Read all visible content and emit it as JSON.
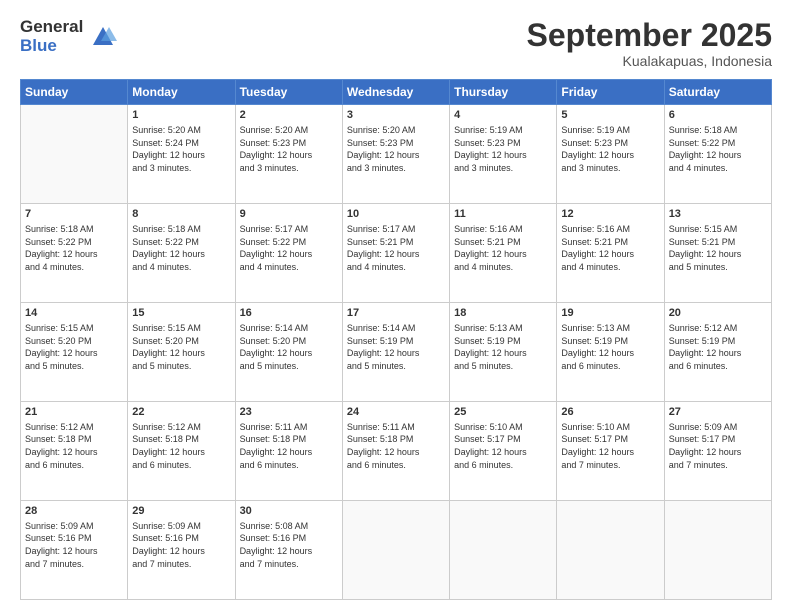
{
  "logo": {
    "general": "General",
    "blue": "Blue"
  },
  "title": "September 2025",
  "subtitle": "Kualakapuas, Indonesia",
  "days_header": [
    "Sunday",
    "Monday",
    "Tuesday",
    "Wednesday",
    "Thursday",
    "Friday",
    "Saturday"
  ],
  "weeks": [
    [
      {
        "day": "",
        "info": ""
      },
      {
        "day": "1",
        "info": "Sunrise: 5:20 AM\nSunset: 5:24 PM\nDaylight: 12 hours\nand 3 minutes."
      },
      {
        "day": "2",
        "info": "Sunrise: 5:20 AM\nSunset: 5:23 PM\nDaylight: 12 hours\nand 3 minutes."
      },
      {
        "day": "3",
        "info": "Sunrise: 5:20 AM\nSunset: 5:23 PM\nDaylight: 12 hours\nand 3 minutes."
      },
      {
        "day": "4",
        "info": "Sunrise: 5:19 AM\nSunset: 5:23 PM\nDaylight: 12 hours\nand 3 minutes."
      },
      {
        "day": "5",
        "info": "Sunrise: 5:19 AM\nSunset: 5:23 PM\nDaylight: 12 hours\nand 3 minutes."
      },
      {
        "day": "6",
        "info": "Sunrise: 5:18 AM\nSunset: 5:22 PM\nDaylight: 12 hours\nand 4 minutes."
      }
    ],
    [
      {
        "day": "7",
        "info": "Sunrise: 5:18 AM\nSunset: 5:22 PM\nDaylight: 12 hours\nand 4 minutes."
      },
      {
        "day": "8",
        "info": "Sunrise: 5:18 AM\nSunset: 5:22 PM\nDaylight: 12 hours\nand 4 minutes."
      },
      {
        "day": "9",
        "info": "Sunrise: 5:17 AM\nSunset: 5:22 PM\nDaylight: 12 hours\nand 4 minutes."
      },
      {
        "day": "10",
        "info": "Sunrise: 5:17 AM\nSunset: 5:21 PM\nDaylight: 12 hours\nand 4 minutes."
      },
      {
        "day": "11",
        "info": "Sunrise: 5:16 AM\nSunset: 5:21 PM\nDaylight: 12 hours\nand 4 minutes."
      },
      {
        "day": "12",
        "info": "Sunrise: 5:16 AM\nSunset: 5:21 PM\nDaylight: 12 hours\nand 4 minutes."
      },
      {
        "day": "13",
        "info": "Sunrise: 5:15 AM\nSunset: 5:21 PM\nDaylight: 12 hours\nand 5 minutes."
      }
    ],
    [
      {
        "day": "14",
        "info": "Sunrise: 5:15 AM\nSunset: 5:20 PM\nDaylight: 12 hours\nand 5 minutes."
      },
      {
        "day": "15",
        "info": "Sunrise: 5:15 AM\nSunset: 5:20 PM\nDaylight: 12 hours\nand 5 minutes."
      },
      {
        "day": "16",
        "info": "Sunrise: 5:14 AM\nSunset: 5:20 PM\nDaylight: 12 hours\nand 5 minutes."
      },
      {
        "day": "17",
        "info": "Sunrise: 5:14 AM\nSunset: 5:19 PM\nDaylight: 12 hours\nand 5 minutes."
      },
      {
        "day": "18",
        "info": "Sunrise: 5:13 AM\nSunset: 5:19 PM\nDaylight: 12 hours\nand 5 minutes."
      },
      {
        "day": "19",
        "info": "Sunrise: 5:13 AM\nSunset: 5:19 PM\nDaylight: 12 hours\nand 6 minutes."
      },
      {
        "day": "20",
        "info": "Sunrise: 5:12 AM\nSunset: 5:19 PM\nDaylight: 12 hours\nand 6 minutes."
      }
    ],
    [
      {
        "day": "21",
        "info": "Sunrise: 5:12 AM\nSunset: 5:18 PM\nDaylight: 12 hours\nand 6 minutes."
      },
      {
        "day": "22",
        "info": "Sunrise: 5:12 AM\nSunset: 5:18 PM\nDaylight: 12 hours\nand 6 minutes."
      },
      {
        "day": "23",
        "info": "Sunrise: 5:11 AM\nSunset: 5:18 PM\nDaylight: 12 hours\nand 6 minutes."
      },
      {
        "day": "24",
        "info": "Sunrise: 5:11 AM\nSunset: 5:18 PM\nDaylight: 12 hours\nand 6 minutes."
      },
      {
        "day": "25",
        "info": "Sunrise: 5:10 AM\nSunset: 5:17 PM\nDaylight: 12 hours\nand 6 minutes."
      },
      {
        "day": "26",
        "info": "Sunrise: 5:10 AM\nSunset: 5:17 PM\nDaylight: 12 hours\nand 7 minutes."
      },
      {
        "day": "27",
        "info": "Sunrise: 5:09 AM\nSunset: 5:17 PM\nDaylight: 12 hours\nand 7 minutes."
      }
    ],
    [
      {
        "day": "28",
        "info": "Sunrise: 5:09 AM\nSunset: 5:16 PM\nDaylight: 12 hours\nand 7 minutes."
      },
      {
        "day": "29",
        "info": "Sunrise: 5:09 AM\nSunset: 5:16 PM\nDaylight: 12 hours\nand 7 minutes."
      },
      {
        "day": "30",
        "info": "Sunrise: 5:08 AM\nSunset: 5:16 PM\nDaylight: 12 hours\nand 7 minutes."
      },
      {
        "day": "",
        "info": ""
      },
      {
        "day": "",
        "info": ""
      },
      {
        "day": "",
        "info": ""
      },
      {
        "day": "",
        "info": ""
      }
    ]
  ]
}
